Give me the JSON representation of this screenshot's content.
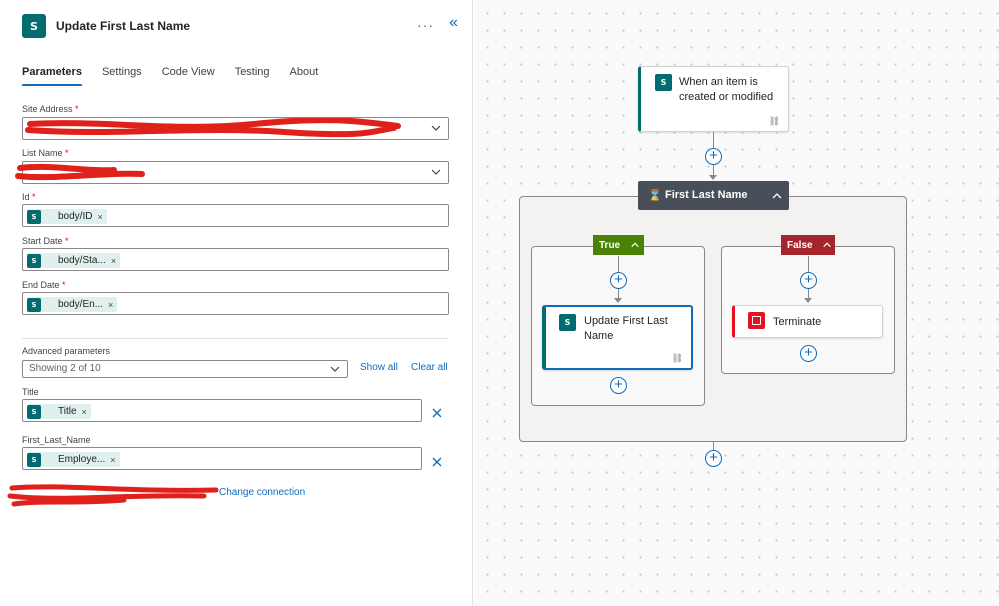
{
  "panel": {
    "title": "Update First Last Name",
    "more_icon": "ellipsis-icon",
    "collapse_icon": "double-chevron-left-icon",
    "tabs": [
      "Parameters",
      "Settings",
      "Code View",
      "Testing",
      "About"
    ],
    "active_tab": "Parameters"
  },
  "fields": {
    "site_address": {
      "label": "Site Address",
      "required_mark": "*",
      "value": ""
    },
    "list_name": {
      "label": "List Name",
      "required_mark": "*",
      "value": ""
    },
    "id": {
      "label": "Id",
      "required_mark": "*",
      "token": "body/ID"
    },
    "start_date": {
      "label": "Start Date",
      "required_mark": "*",
      "token": "body/Sta..."
    },
    "end_date": {
      "label": "End Date",
      "required_mark": "*",
      "token": "body/En..."
    }
  },
  "advanced": {
    "label": "Advanced parameters",
    "selected": "Showing 2 of 10",
    "show_all": "Show all",
    "clear_all": "Clear all"
  },
  "extra_fields": {
    "title": {
      "label": "Title",
      "token": "Title"
    },
    "first_last_name": {
      "label": "First_Last_Name",
      "token": "Employe..."
    }
  },
  "connection": {
    "change_link": "Change connection"
  },
  "token_remove": "×",
  "canvas": {
    "trigger": "When an item is created or modified",
    "condition": "First Last Name",
    "true_label": "True",
    "false_label": "False",
    "true_action": "Update First Last Name",
    "false_action": "Terminate"
  },
  "colors": {
    "sharepoint": "#036c70",
    "accent": "#0f6cbd",
    "true_branch": "#498205",
    "false_branch": "#a4262c",
    "terminate": "#e81123",
    "condition_header": "#484f58"
  }
}
